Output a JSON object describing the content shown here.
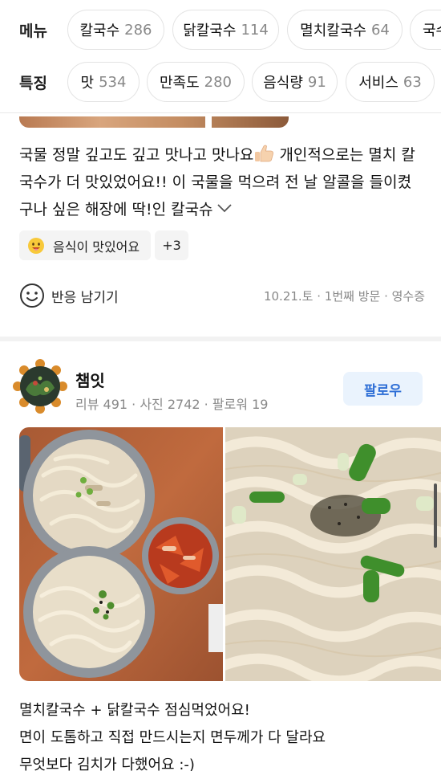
{
  "filters": {
    "menu": {
      "label": "메뉴",
      "chips": [
        {
          "name": "칼국수",
          "count": "286"
        },
        {
          "name": "닭칼국수",
          "count": "114"
        },
        {
          "name": "멸치칼국수",
          "count": "64"
        },
        {
          "name": "국수",
          "count": ""
        }
      ]
    },
    "features": {
      "label": "특징",
      "chips": [
        {
          "name": "맛",
          "count": "534"
        },
        {
          "name": "만족도",
          "count": "280"
        },
        {
          "name": "음식량",
          "count": "91"
        },
        {
          "name": "서비스",
          "count": "63"
        }
      ]
    }
  },
  "review1": {
    "text_part1": "국물 정말 깊고도 깊고 맛나고 맛나요",
    "text_part2": " 개인적으로는 멸치 칼국수가 더 맛있었어요!! 이 국물을 먹으려 전 날 알콜을 들이켰구나 싶은 해장에 딱!인 칼국슈",
    "tag_label": "음식이 맛있어요",
    "tag_more": "+3",
    "reaction_label": "반응 남기기",
    "meta": "10.21.토 · 1번째 방문 · 영수증"
  },
  "review2": {
    "user_name": "챔잇",
    "user_stats": "리뷰 491 · 사진 2742 · 팔로워 19",
    "follow_label": "팔로우",
    "lines": [
      "멸치칼국수 + 닭칼국수 점심먹었어요!",
      "면이 도톰하고 직접 만드시는지 면두께가 다 달라요",
      "무엇보다 김치가 다했어요 :-)"
    ]
  },
  "colors": {
    "accent_blue": "#2f6fd6",
    "follow_bg": "#eaf3fd",
    "meta_gray": "#888888"
  }
}
